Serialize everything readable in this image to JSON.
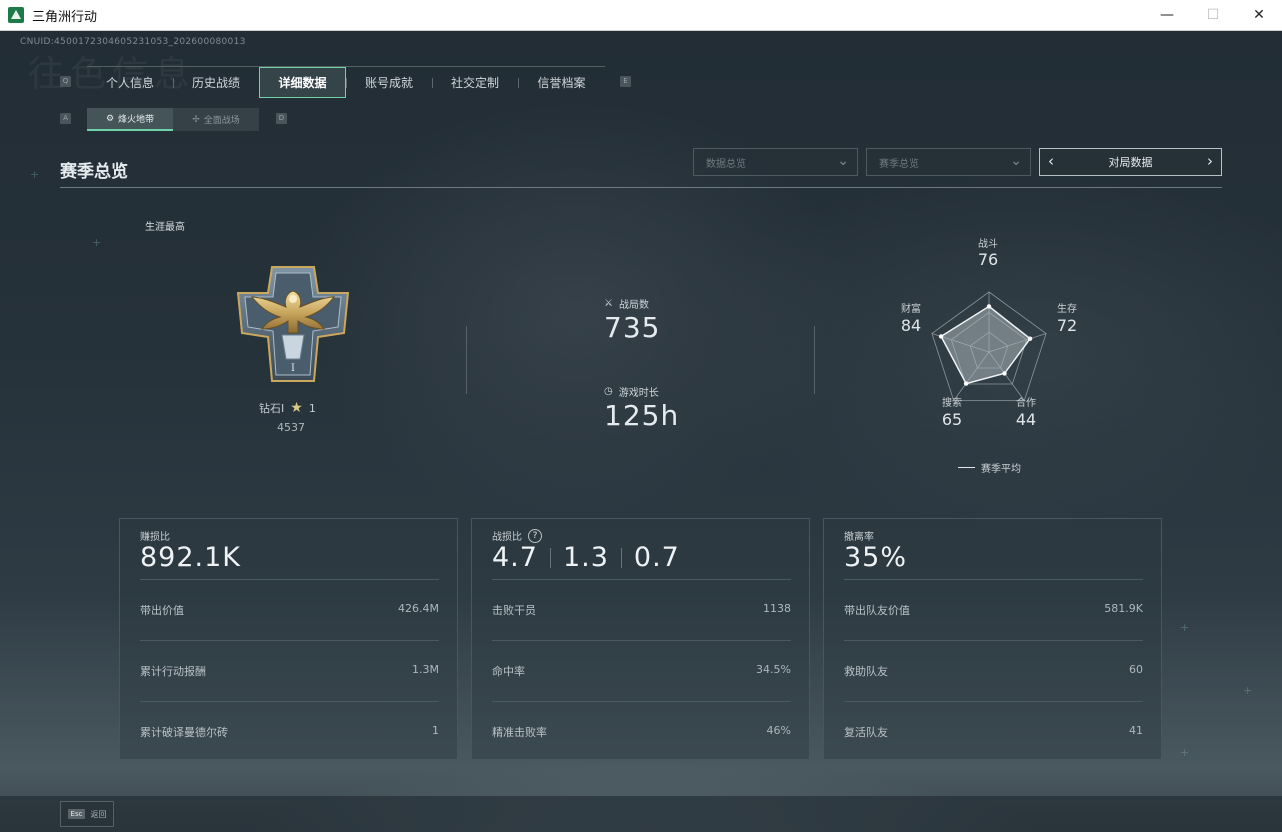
{
  "window": {
    "title": "三角洲行动",
    "min": "—",
    "max": "☐",
    "close": "✕"
  },
  "uid": "CNUID:4500172304605231053_202600080013",
  "watermark": "往色信息",
  "key_hints": {
    "prev_tab": "Q",
    "next_tab": "E",
    "prev_sub": "A",
    "next_sub": "D"
  },
  "tabs": [
    {
      "label": "个人信息"
    },
    {
      "label": "历史战绩"
    },
    {
      "label": "详细数据"
    },
    {
      "label": "账号成就"
    },
    {
      "label": "社交定制"
    },
    {
      "label": "信誉档案"
    }
  ],
  "subtabs": [
    {
      "label": "烽火地带",
      "icon": "⚙"
    },
    {
      "label": "全面战场",
      "icon": "✢"
    }
  ],
  "section": {
    "title": "赛季总览",
    "dropdown1": "数据总览",
    "dropdown2": "赛季总览",
    "pager": "对局数据",
    "pager_left": "‹",
    "pager_right": "›"
  },
  "career": {
    "label": "生涯最高",
    "rank": "钻石Ⅰ",
    "stars": "1",
    "score": "4537"
  },
  "matches": {
    "label": "战局数",
    "value": "735",
    "icon": "⚔"
  },
  "playtime": {
    "label": "游戏时长",
    "value": "125h",
    "icon": "◷"
  },
  "radar": {
    "axes": [
      {
        "label": "战斗",
        "value": "76"
      },
      {
        "label": "生存",
        "value": "72"
      },
      {
        "label": "合作",
        "value": "44"
      },
      {
        "label": "搜索",
        "value": "65"
      },
      {
        "label": "财富",
        "value": "84"
      }
    ],
    "legend": "赛季平均"
  },
  "cards": [
    {
      "title": "赚损比",
      "value": "892.1K",
      "rows": [
        {
          "label": "带出价值",
          "value": "426.4M"
        },
        {
          "label": "累计行动报酬",
          "value": "1.3M"
        },
        {
          "label": "累计破译曼德尔砖",
          "value": "1"
        }
      ]
    },
    {
      "title": "战损比",
      "help": "?",
      "values": [
        "4.7",
        "1.3",
        "0.7"
      ],
      "rows": [
        {
          "label": "击败干员",
          "value": "1138"
        },
        {
          "label": "命中率",
          "value": "34.5%"
        },
        {
          "label": "精准击败率",
          "value": "46%"
        }
      ]
    },
    {
      "title": "撤离率",
      "value": "35%",
      "rows": [
        {
          "label": "带出队友价值",
          "value": "581.9K"
        },
        {
          "label": "救助队友",
          "value": "60"
        },
        {
          "label": "复活队友",
          "value": "41"
        }
      ]
    }
  ],
  "footer": {
    "key": "Esc",
    "label": "返回"
  }
}
